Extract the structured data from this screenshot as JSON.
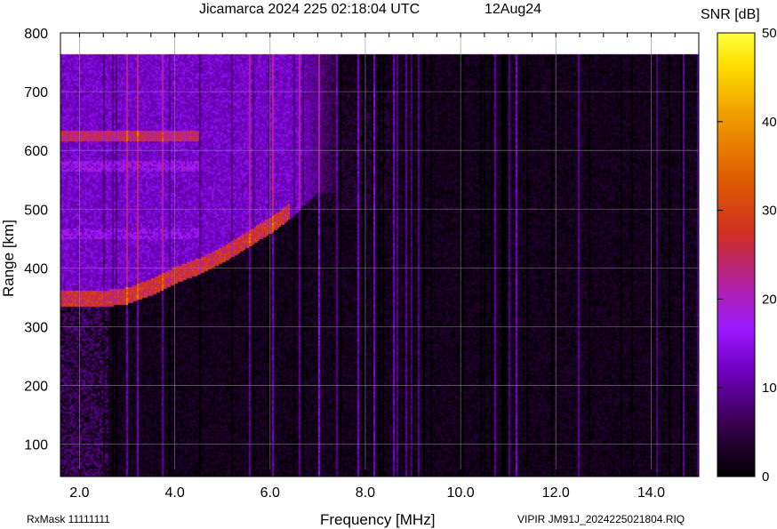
{
  "chart_data": {
    "type": "heatmap",
    "title": "Jicamarca 2024 225 02:18:04 UTC",
    "date_label": "12Aug24",
    "xlabel": "Frequency [MHz]",
    "ylabel": "Range [km]",
    "colorbar_label": "SNR [dB]",
    "xlim": [
      1.6,
      15.0
    ],
    "ylim": [
      45,
      800
    ],
    "x_ticks": [
      2.0,
      4.0,
      6.0,
      8.0,
      10.0,
      12.0,
      14.0
    ],
    "x_tick_labels": [
      "2.0",
      "4.0",
      "6.0",
      "8.0",
      "10.0",
      "12.0",
      "14.0"
    ],
    "y_ticks": [
      100,
      200,
      300,
      400,
      500,
      600,
      700,
      800
    ],
    "y_tick_labels": [
      "100",
      "200",
      "300",
      "400",
      "500",
      "600",
      "700",
      "800"
    ],
    "colorbar_range": [
      0,
      50
    ],
    "colorbar_ticks": [
      0,
      10,
      20,
      30,
      40,
      50
    ],
    "colorbar_tick_labels": [
      "0",
      "10",
      "20",
      "30",
      "40",
      "50"
    ],
    "colormap": [
      "#000000",
      "#3a0050",
      "#6a00a8",
      "#8a10ff",
      "#b020b0",
      "#d03020",
      "#e06000",
      "#f0a000",
      "#ffe000",
      "#ffff40"
    ],
    "grid": true,
    "data_extent_range": [
      45,
      765
    ],
    "features": [
      {
        "kind": "echo_trace",
        "x": [
          1.6,
          2.5,
          3.0,
          3.5,
          4.0,
          4.5,
          5.0,
          5.5,
          6.0,
          6.5,
          7.0
        ],
        "y": [
          335,
          335,
          340,
          355,
          375,
          390,
          410,
          435,
          460,
          490,
          530
        ],
        "snr": 26
      },
      {
        "kind": "multi_hop_band",
        "x_range": [
          1.6,
          4.5
        ],
        "y": 625,
        "snr": 24
      },
      {
        "kind": "multi_hop_band",
        "x_range": [
          1.6,
          4.5
        ],
        "y": 575,
        "snr": 16
      },
      {
        "kind": "multi_hop_band",
        "x_range": [
          1.6,
          4.5
        ],
        "y": 460,
        "snr": 15
      }
    ]
  },
  "footer": {
    "rxmask": "RxMask 11111111",
    "source": "VIPIR  JM91J_2024225021804.RIQ"
  }
}
